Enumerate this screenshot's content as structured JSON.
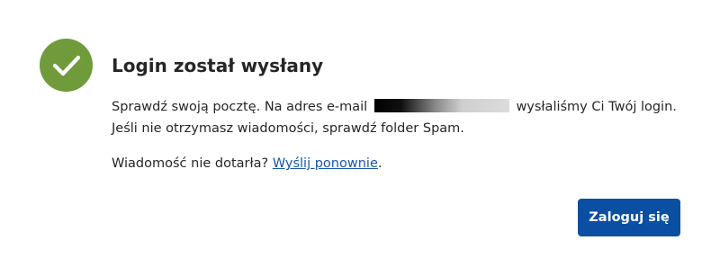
{
  "dialog": {
    "title": "Login został wysłany",
    "message_part1": "Sprawdź swoją pocztę. Na adres e-mail",
    "message_part2": "wysłaliśmy Ci Twój login. Jeśli nie otrzymasz wiadomości, sprawdź folder Spam.",
    "resend_prefix": "Wiadomość nie dotarła?",
    "resend_link": "Wyślij ponownie",
    "resend_suffix": ".",
    "login_button": "Zaloguj się"
  },
  "icons": {
    "status_icon": "check-circle-icon"
  },
  "colors": {
    "success": "#6f9b3b",
    "primary": "#0b4fa2",
    "link": "#1a56a8",
    "text": "#262626"
  }
}
